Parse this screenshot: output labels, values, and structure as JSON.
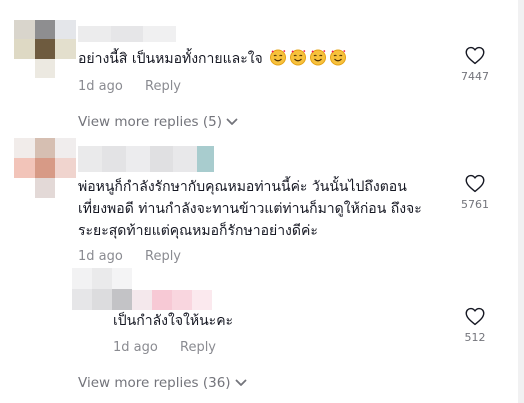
{
  "comments": [
    {
      "text": "อย่างนี้สิ เป็นหมอทั้งกายและใจ",
      "emojis": [
        "smiling-face-with-hearts",
        "smiling-face-with-hearts",
        "smiling-face-with-hearts",
        "smiling-face-with-hearts"
      ],
      "time": "1d ago",
      "reply_label": "Reply",
      "likes": "7447",
      "view_more": "View more replies (5)"
    },
    {
      "text_lines": [
        "พ่อหนูก็กำลังรักษากับคุณหมอท่านนี้ค่ะ วันนั้นไปถึงตอน",
        "เที่ยงพอดี ท่านกำลังจะทานข้าวแต่ท่านก็มาดูให้ก่อน ถึงจะ",
        "ระยะสุดท้ายแต่คุณหมอก็รักษาอย่างดีค่ะ"
      ],
      "time": "1d ago",
      "reply_label": "Reply",
      "likes": "5761",
      "reply": {
        "text": "เป็นกำลังใจให้นะคะ",
        "time": "1d ago",
        "reply_label": "Reply",
        "likes": "512"
      },
      "view_more": "View more replies (36)"
    }
  ],
  "icons": {
    "like": "heart-outline-icon",
    "expand": "chevron-down-icon",
    "emoji": "smiling-face-with-hearts"
  },
  "colors": {
    "text": "#161823",
    "meta": "#8a8b91",
    "emoji_face": "#f7c13c",
    "emoji_heart": "#ee1d52"
  }
}
